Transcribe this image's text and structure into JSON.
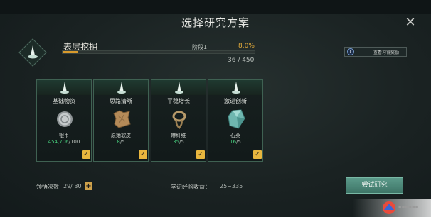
{
  "title": "选择研究方案",
  "plan": {
    "name": "表层挖掘",
    "stage_label": "阶段1",
    "stage_percent": "8.0%",
    "progress_text": "36 / 450",
    "progress_fraction": 0.08
  },
  "rules_button": {
    "label": "查看习得奖励",
    "icon": "info-icon"
  },
  "cards": [
    {
      "label": "基础物资",
      "item_name": "银币",
      "progress_current": "454,706",
      "progress_total": "/100",
      "icon": "silver-coin-icon",
      "checked": true
    },
    {
      "label": "思路清晰",
      "item_name": "原始软皮",
      "progress_current": "8",
      "progress_total": "/5",
      "icon": "raw-leather-icon",
      "checked": true
    },
    {
      "label": "平稳增长",
      "item_name": "麻纤维",
      "progress_current": "35",
      "progress_total": "/5",
      "icon": "hemp-fiber-icon",
      "checked": true
    },
    {
      "label": "激进创新",
      "item_name": "石英",
      "progress_current": "16",
      "progress_total": "/5",
      "icon": "quartz-icon",
      "checked": true
    }
  ],
  "attempts": {
    "label": "领悟次数",
    "value": "29/ 30"
  },
  "exp": {
    "label": "学识经验收益：",
    "value": "25~335"
  },
  "try_button": {
    "label": "尝试研究"
  },
  "colors": {
    "accent": "#d89a2c",
    "progress_green": "#45c97a",
    "card_border": "#3f6152",
    "button": "#4f8a7a"
  }
}
